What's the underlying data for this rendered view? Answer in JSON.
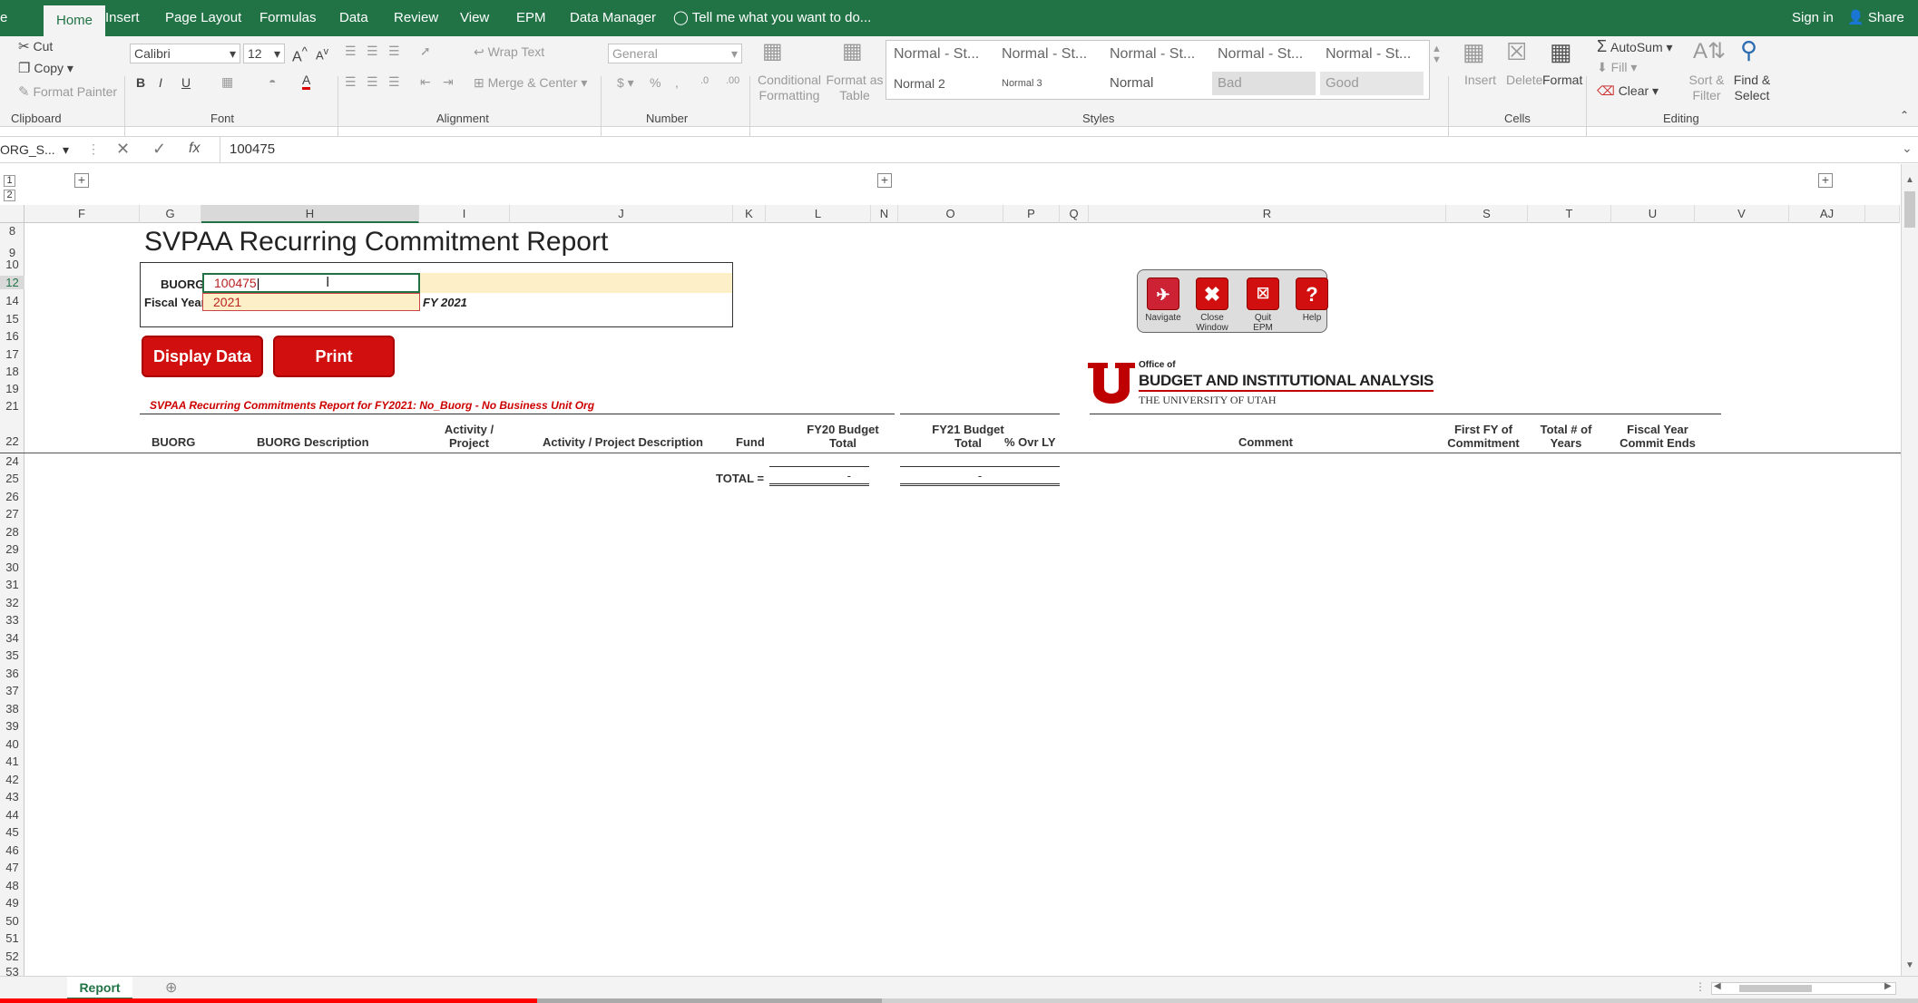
{
  "ribbon_tabs": [
    "e",
    "Home",
    "Insert",
    "Page Layout",
    "Formulas",
    "Data",
    "Review",
    "View",
    "EPM",
    "Data Manager"
  ],
  "tell_me": "Tell me what you want to do...",
  "sign_in": "Sign in",
  "share": "Share",
  "clipboard": {
    "cut": "Cut",
    "copy": "Copy",
    "format_painter": "Format Painter",
    "label": "Clipboard"
  },
  "font": {
    "name": "Calibri",
    "size": "12",
    "label": "Font"
  },
  "alignment": {
    "wrap_text": "Wrap Text",
    "merge_center": "Merge & Center",
    "label": "Alignment"
  },
  "number": {
    "format": "General",
    "label": "Number"
  },
  "styles": {
    "conditional": "Conditional Formatting",
    "format_table": "Format as Table",
    "cells": [
      "Normal - St...",
      "Normal - St...",
      "Normal - St...",
      "Normal - St...",
      "Normal - St...",
      "Normal 2",
      "Normal 3",
      "Normal",
      "Bad",
      "Good"
    ],
    "label": "Styles"
  },
  "cells": {
    "insert": "Insert",
    "delete": "Delete",
    "format": "Format",
    "label": "Cells"
  },
  "editing": {
    "autosum": "AutoSum",
    "fill": "Fill",
    "clear": "Clear",
    "sort_filter": "Sort & Filter",
    "find_select": "Find & Select",
    "label": "Editing"
  },
  "name_box": "ORG_S...",
  "formula_value": "100475",
  "columns": [
    "F",
    "G",
    "H",
    "I",
    "J",
    "K",
    "L",
    "N",
    "O",
    "P",
    "Q",
    "R",
    "S",
    "T",
    "U",
    "V",
    "AJ"
  ],
  "rows": [
    "8",
    "9",
    "10",
    "12",
    "14",
    "15",
    "16",
    "17",
    "18",
    "19",
    "21",
    "22",
    "24",
    "25",
    "26",
    "27",
    "28",
    "29",
    "30",
    "31",
    "32",
    "33",
    "34",
    "35",
    "36",
    "37",
    "38",
    "39",
    "40",
    "41",
    "42",
    "43",
    "44",
    "45",
    "46",
    "47",
    "48",
    "49",
    "50",
    "51",
    "52",
    "53"
  ],
  "report": {
    "title": "SVPAA Recurring Commitment Report",
    "buorg_label": "BUORG",
    "buorg_value": "100475",
    "fiscal_year_label": "Fiscal Year",
    "fiscal_year_value": "2021",
    "fy_display": "FY 2021",
    "display_data": "Display Data",
    "print": "Print",
    "subtitle": "SVPAA Recurring Commitments Report for FY2021:  No_Buorg - No Business Unit Org",
    "headers": {
      "buorg": "BUORG",
      "buorg_desc": "BUORG Description",
      "activity": "Activity / Project",
      "activity_desc": "Activity / Project Description",
      "fund": "Fund",
      "fy20": "FY20 Budget Total",
      "fy21": "FY21 Budget Total",
      "pct": "% Ovr LY",
      "comment": "Comment",
      "first_fy": "First FY of Commitment",
      "total_years": "Total # of Years",
      "commit_ends": "Fiscal Year Commit Ends"
    },
    "total_label": "TOTAL =",
    "fy20_total": "-",
    "fy21_total": "-"
  },
  "nav_buttons": [
    {
      "label": "Navigate"
    },
    {
      "label": "Close Window"
    },
    {
      "label": "Quit EPM"
    },
    {
      "label": "Help"
    }
  ],
  "logo": {
    "office_of": "Office of",
    "name": "BUDGET AND INSTITUTIONAL ANALYSIS",
    "university": "THE UNIVERSITY OF UTAH"
  },
  "sheet_tab": "Report"
}
